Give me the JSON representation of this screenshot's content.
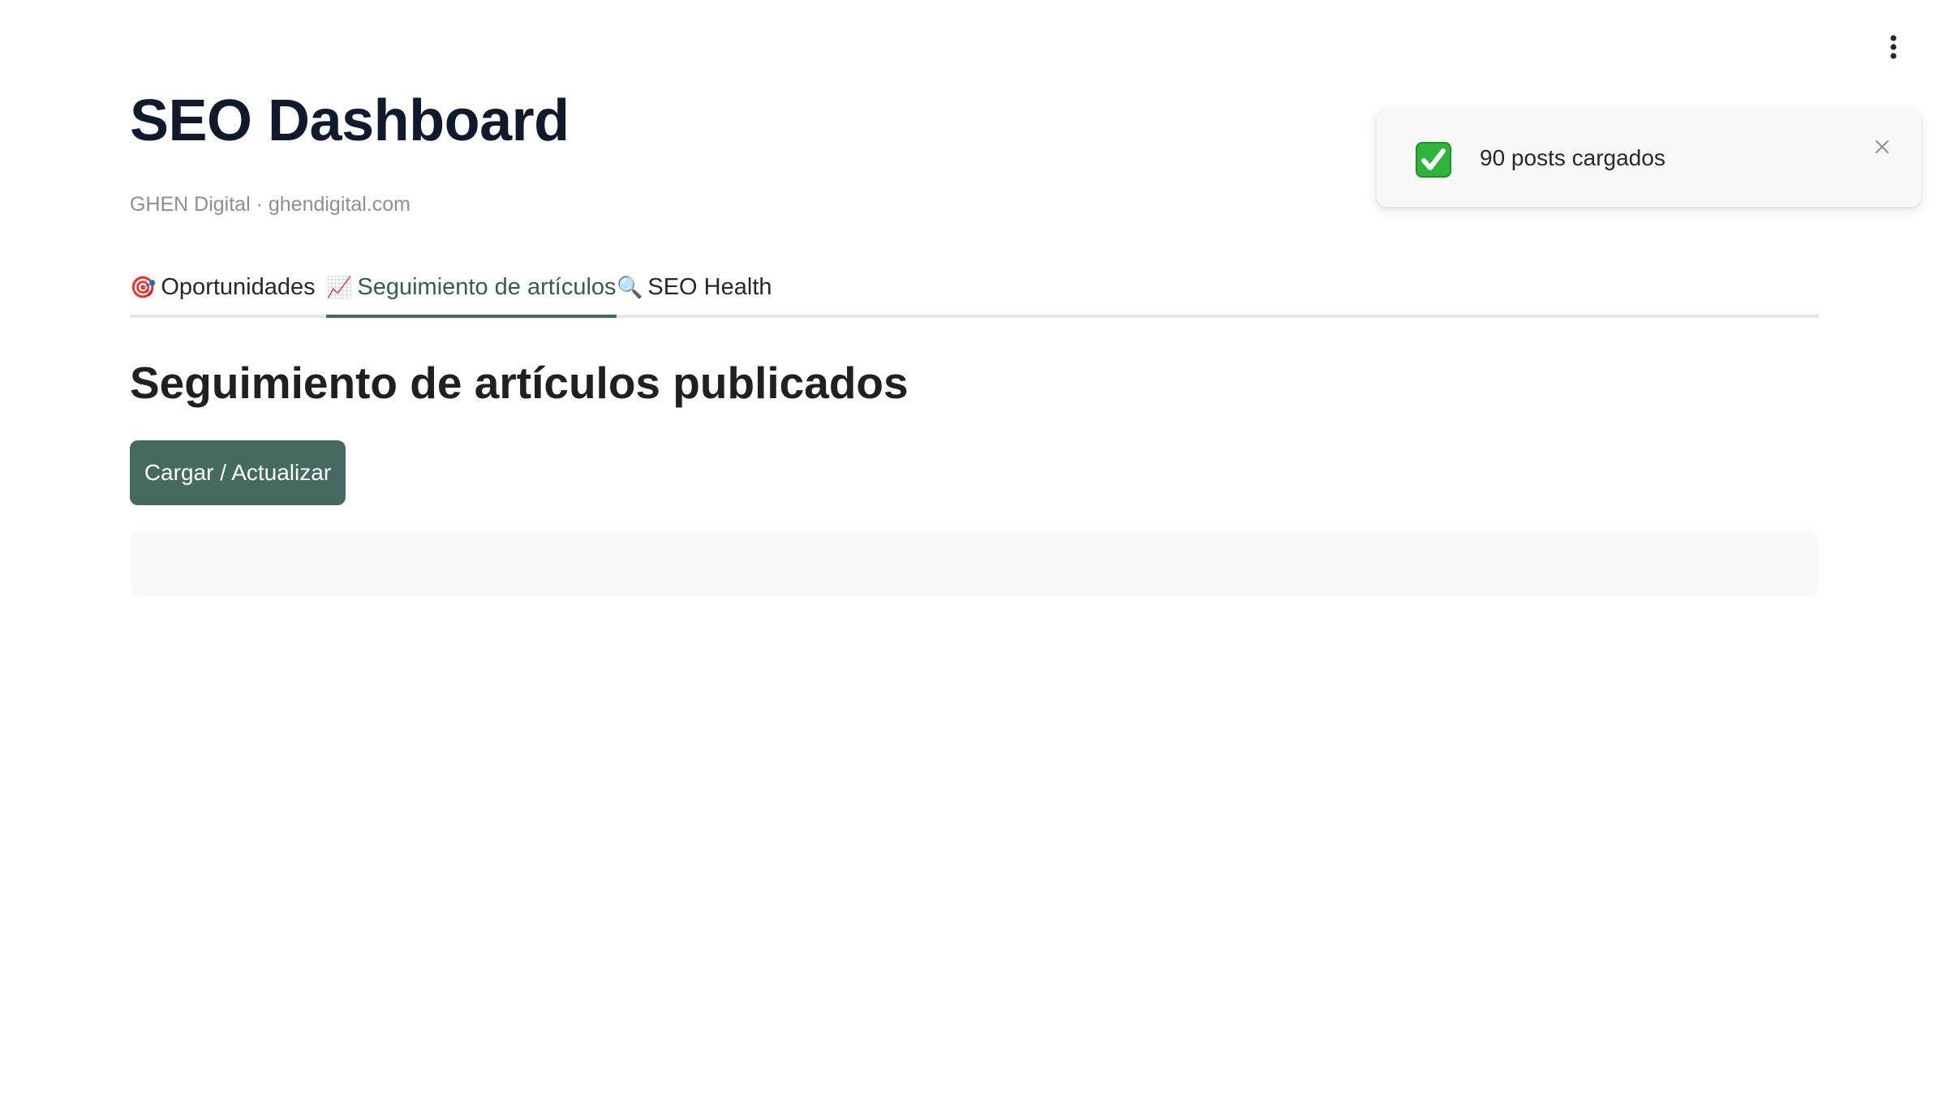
{
  "header": {
    "title": "SEO Dashboard",
    "subtitle": "GHEN Digital · ghendigital.com",
    "menu_icon": "more-vertical-icon"
  },
  "tabs": [
    {
      "emoji": "🎯",
      "icon": "target-icon",
      "label": "Oportunidades",
      "active": false
    },
    {
      "emoji": "📈",
      "icon": "chart-increasing-icon",
      "label": "Seguimiento de artículos",
      "active": true
    },
    {
      "emoji": "🔍",
      "icon": "magnifier-icon",
      "label": "SEO Health",
      "active": false
    }
  ],
  "main": {
    "section_title": "Seguimiento de artículos publicados",
    "load_button_label": "Cargar / Actualizar"
  },
  "toast": {
    "icon": "check-mark-button-icon",
    "message": "90 posts cargados",
    "close_icon": "close-icon"
  },
  "colors": {
    "accent": "#446a62",
    "active_tab_text": "#2e5e54",
    "title_text": "#0f1b2d",
    "subtitle_text": "#8b8f96",
    "toast_check": "#2fb53a"
  }
}
